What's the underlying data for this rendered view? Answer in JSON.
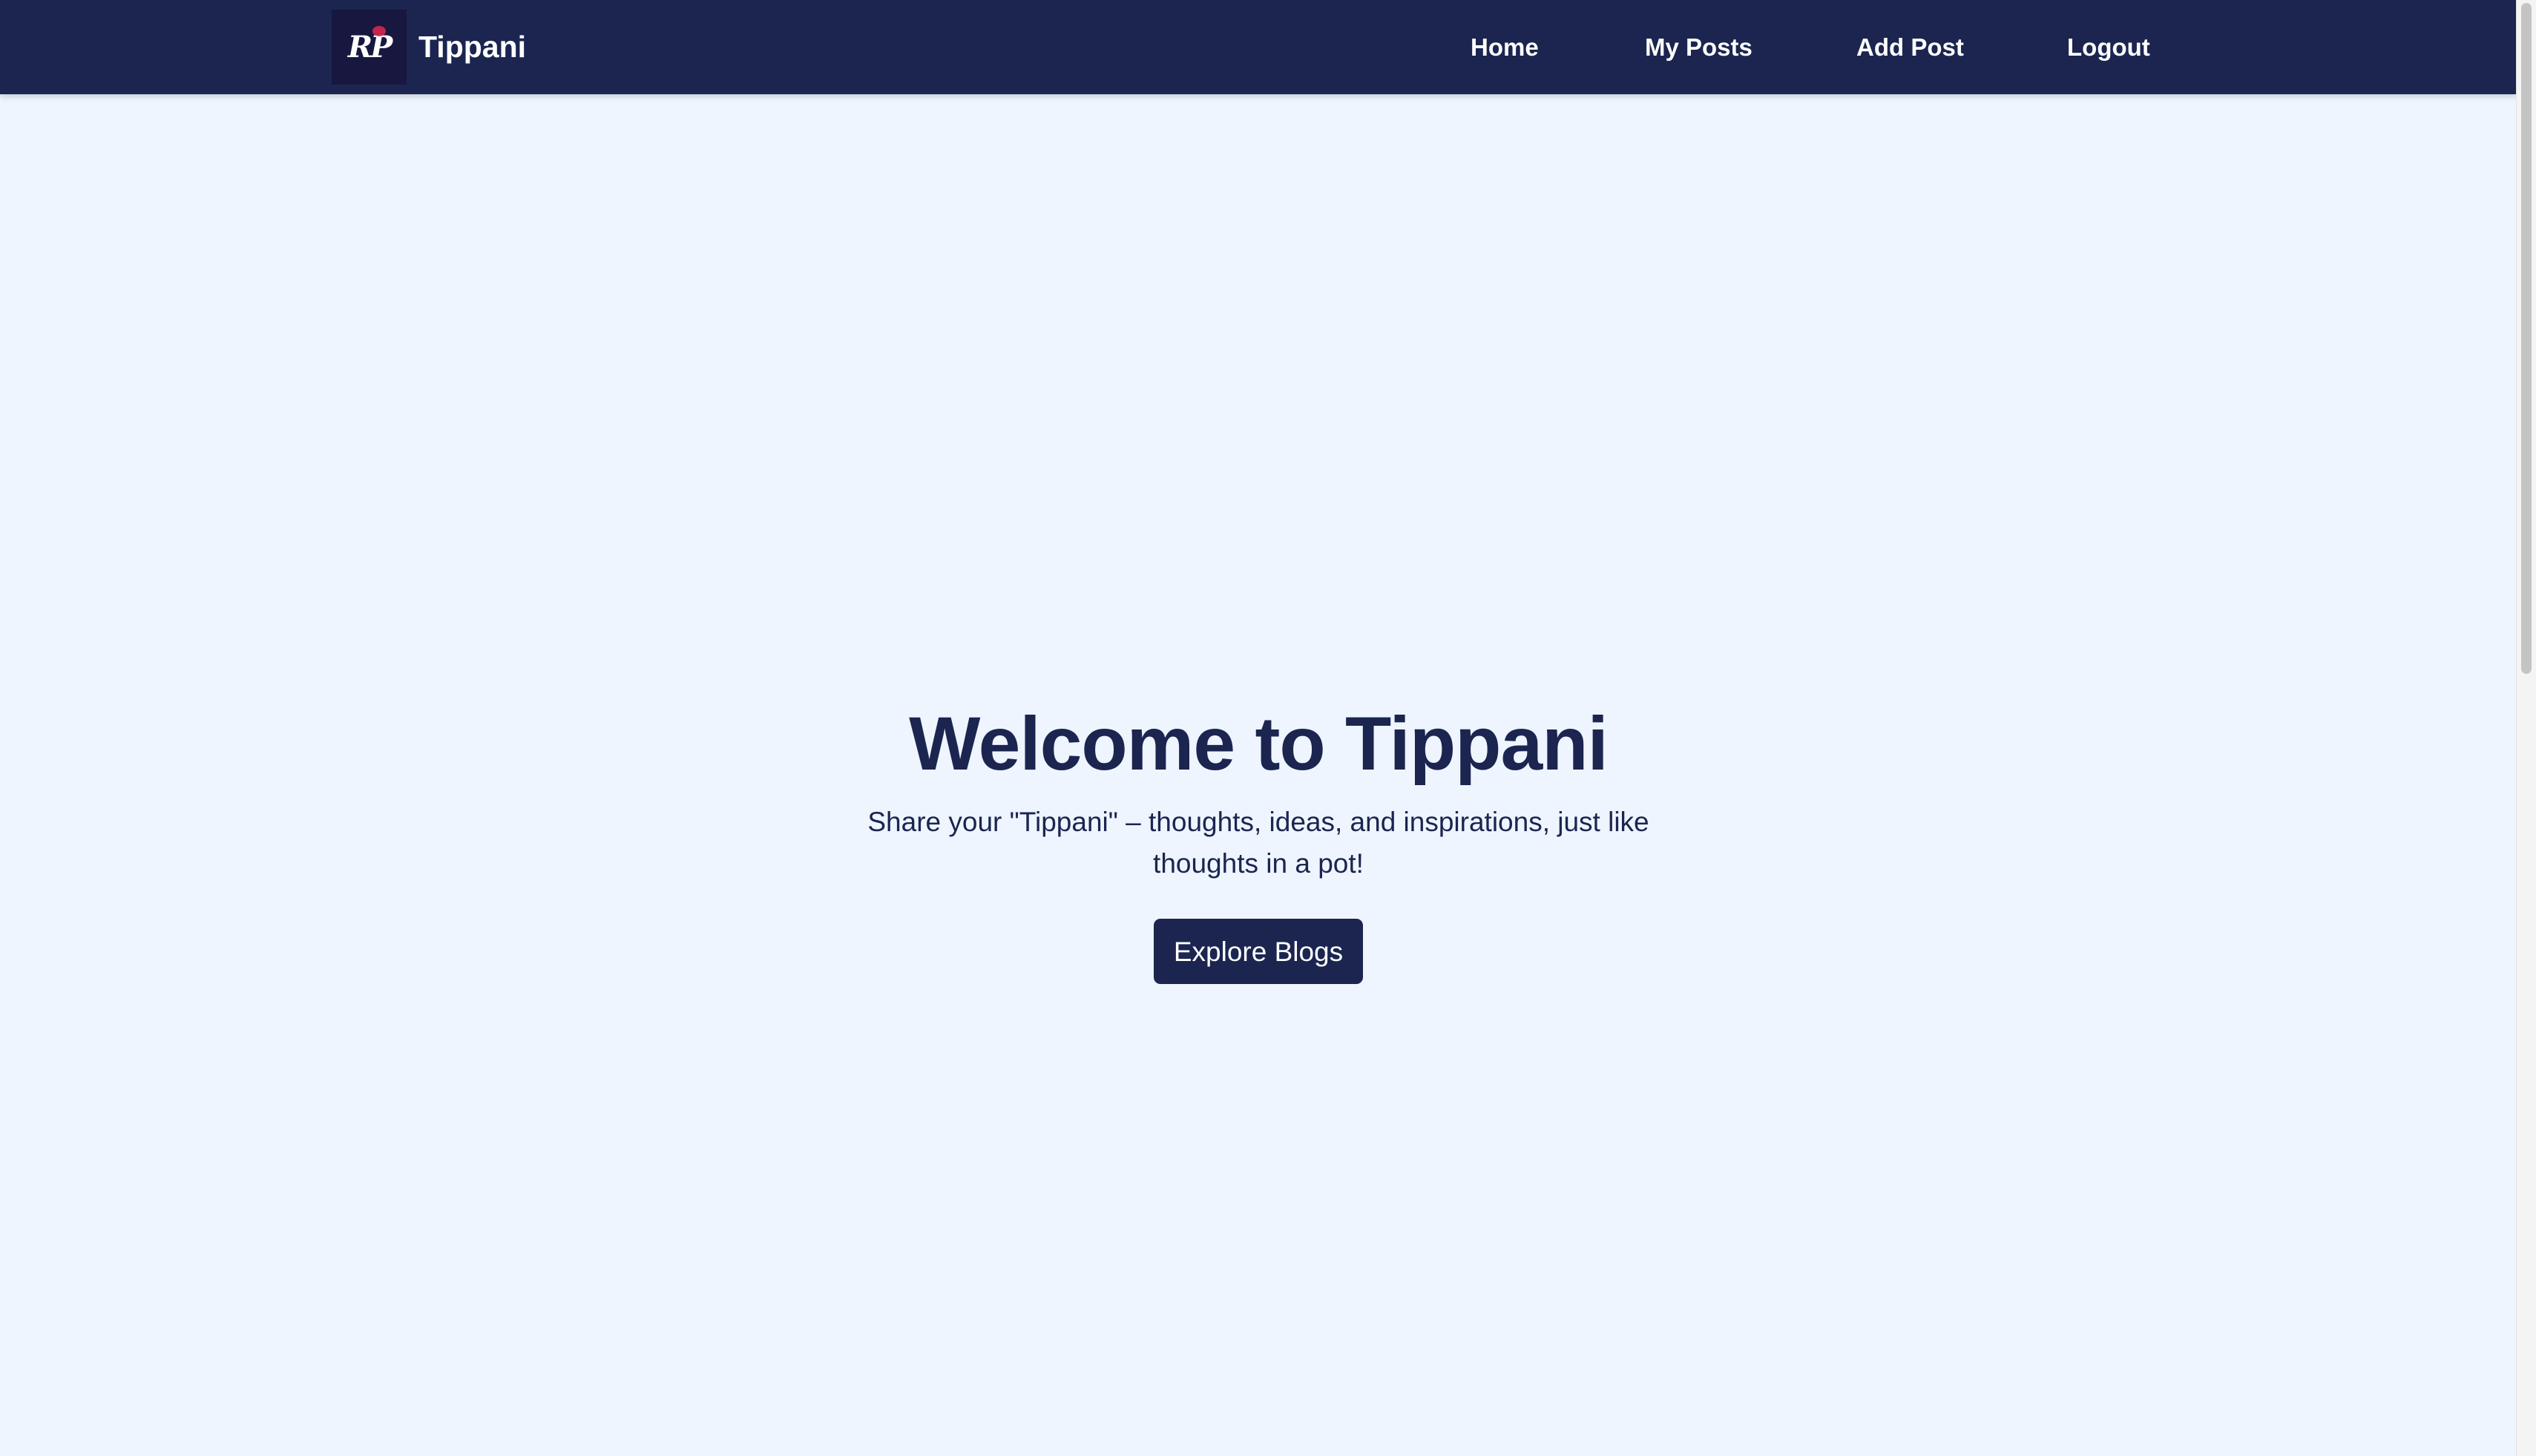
{
  "navbar": {
    "logo_text": "RP",
    "brand_name": "Tippani",
    "links": [
      {
        "label": "Home"
      },
      {
        "label": "My Posts"
      },
      {
        "label": "Add Post"
      },
      {
        "label": "Logout"
      }
    ]
  },
  "hero": {
    "title": "Welcome to Tippani",
    "subtitle": "Share your \"Tippani\" – thoughts, ideas, and inspirations, just like thoughts in a pot!",
    "button_label": "Explore Blogs"
  },
  "colors": {
    "navbar_bg": "#1b2550",
    "page_bg": "#eef5fe",
    "accent": "#1b2550",
    "logo_bg": "#17173f",
    "logo_splash": "#e0294f"
  },
  "icons": {
    "logo": "rp-logo-icon"
  }
}
